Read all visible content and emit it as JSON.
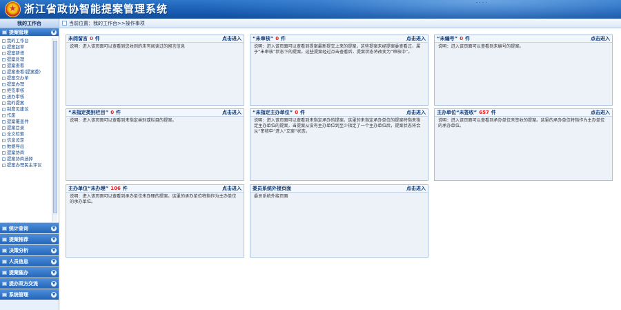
{
  "app": {
    "title": "浙江省政协智能提案管理系统",
    "header_marks": "·  ·  ·  ·"
  },
  "sidebar": {
    "header": "我的工作台",
    "active_group": "提案管理",
    "items": [
      "我的工作台",
      "提案起草",
      "提案新增",
      "提案处理",
      "提案查看",
      "提案查看(提案委)",
      "提案交办单",
      "提案办理",
      "拒签审核",
      "送办审核",
      "我的提案",
      "制度见建议",
      "作废",
      "提案覆盖件",
      "提案目录",
      "全文检索",
      "信息设定",
      "数据导出",
      "提案协商",
      "提案协商选择",
      "提案办理民主评议"
    ],
    "groups": [
      "统计查询",
      "提案推荐",
      "决策分析",
      "人员信息",
      "提案催办",
      "提办双方交流",
      "系统管理"
    ]
  },
  "breadcrumb": "当前位置：我的工作台>>操作事项",
  "cards": [
    {
      "title": "未阅留言",
      "count": "0",
      "unit": "件",
      "link": "点击进入",
      "desc": "说明：进入该页面可以查看到您收到的未有阅读过的留言信息"
    },
    {
      "title": "“未审核”",
      "count": "0",
      "unit": "件",
      "link": "点击进入",
      "desc": "说明：进入该页面可以查看到提案最新提交上来的提案，这些提案未经提案委查看过，属于“未审核”状态下的提案。这些提案经过点击查看后，提案状态将改变为“审核中”。"
    },
    {
      "title": "“未编号”",
      "count": "0",
      "unit": "件",
      "link": "点击进入",
      "desc": "说明：进入该页面可以查看到未编号的提案。"
    },
    {
      "title": "“未指定类别栏目”",
      "count": "0",
      "unit": "件",
      "link": "点击进入",
      "desc": "说明：进入该页面可以查看到未指定类别或栏目的提案。"
    },
    {
      "title": "“未指定主办单位”",
      "count": "0",
      "unit": "件",
      "link": "点击进入",
      "desc": "说明：进入该页面可以查看到未指定承办的提案。这里的未指定承办单位的提案特指未指定主办单位的提案，当提案从没有主办单位到至少指定了一个主办单位后，提案状态将会从“审核中”进入“立案”状态。"
    },
    {
      "title": "主办单位“未签收”",
      "count": "657",
      "unit": "件",
      "link": "点击进入",
      "desc": "说明：进入该页面可以查看到承办单位未签收的提案。这里的承办单位特指作为主办单位的承办单位。"
    },
    {
      "title": "主办单位“未办理”",
      "count": "106",
      "unit": "件",
      "link": "点击进入",
      "desc": "说明：进入该页面可以查看到承办单位未办理的提案。这里的承办单位特指作为主办单位的承办单位。"
    },
    {
      "title": "委员系统外接页面",
      "count": "",
      "unit": "",
      "link": "点击进入",
      "desc": "委员系统外接页面"
    }
  ]
}
